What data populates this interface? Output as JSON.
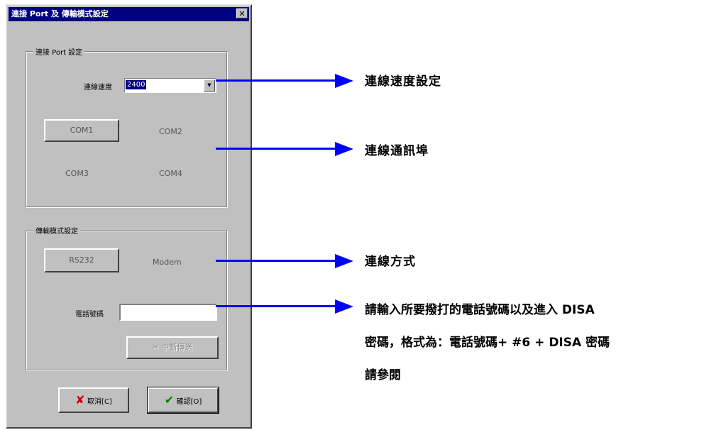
{
  "dialog": {
    "title": "連接 Port 及 傳輸模式設定",
    "close_label": "✕"
  },
  "port_group": {
    "legend": "連接 Port 設定",
    "speed_label": "連線速度",
    "speed_value": "2400",
    "com1": "COM1",
    "com2": "COM2",
    "com3": "COM3",
    "com4": "COM4"
  },
  "mode_group": {
    "legend": "傳輸模式設定",
    "rs232": "RS232",
    "modem": "Modem",
    "phone_label": "電話號碼",
    "phone_value": "",
    "hangup_label": "中斷傳送"
  },
  "footer": {
    "cancel_label": "取消[C]",
    "ok_label": "確認[O]"
  },
  "annotations": {
    "speed": "連線速度設定",
    "port": "連線通訊埠",
    "mode": "連線方式",
    "phone_line1": "請輸入所要撥打的電話號碼以及進入 DISA",
    "phone_line2": "密碼，格式為：電話號碼+ #6 + DISA 密碼",
    "phone_line3": "請參閱"
  },
  "colors": {
    "arrow": "#0000ff",
    "titlebar": "#000080",
    "dialog_bg": "#c0c0c0"
  }
}
